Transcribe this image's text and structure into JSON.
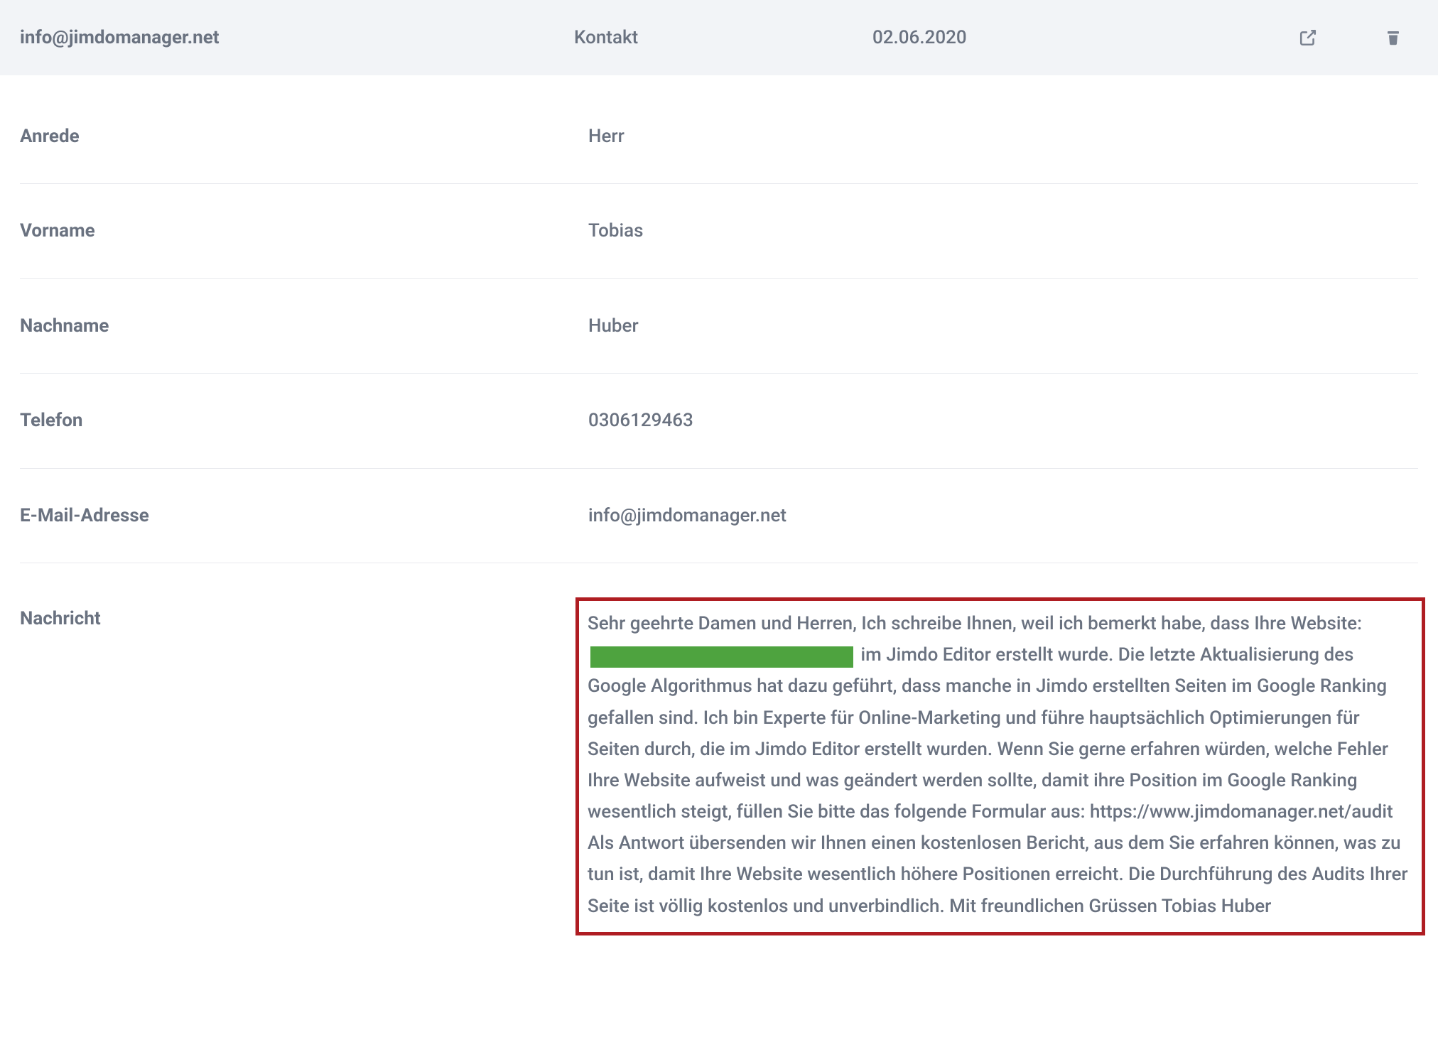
{
  "header": {
    "email": "info@jimdomanager.net",
    "type": "Kontakt",
    "date": "02.06.2020"
  },
  "fields": {
    "anrede": {
      "label": "Anrede",
      "value": "Herr"
    },
    "vorname": {
      "label": "Vorname",
      "value": "Tobias"
    },
    "nachname": {
      "label": "Nachname",
      "value": "Huber"
    },
    "telefon": {
      "label": "Telefon",
      "value": "0306129463"
    },
    "email": {
      "label": "E-Mail-Adresse",
      "value": "info@jimdomanager.net"
    }
  },
  "message": {
    "label": "Nachricht",
    "pre_redact": "Sehr geehrte Damen und Herren, Ich schreibe Ihnen, weil ich bemerkt habe, dass Ihre Website:",
    "post_redact": "im Jimdo Editor erstellt wurde. Die letzte Aktualisierung des Google Algorithmus hat dazu geführt, dass manche in Jimdo erstellten Seiten im Google Ranking gefallen sind. Ich bin Experte für Online-Marketing und führe hauptsächlich Optimierungen für Seiten durch, die im Jimdo Editor erstellt wurden. Wenn Sie gerne erfahren würden, welche Fehler Ihre Website aufweist und was geändert werden sollte, damit ihre Position im Google Ranking wesentlich steigt, füllen Sie bitte das folgende Formular aus: https://www.jimdomanager.net/audit Als Antwort übersenden wir Ihnen einen kostenlosen Bericht, aus dem Sie erfahren können, was zu tun ist, damit Ihre Website wesentlich höhere Positionen erreicht. Die Durchführung des Audits Ihrer Seite ist völlig kostenlos und unverbindlich. Mit freundlichen Grüssen Tobias Huber"
  }
}
